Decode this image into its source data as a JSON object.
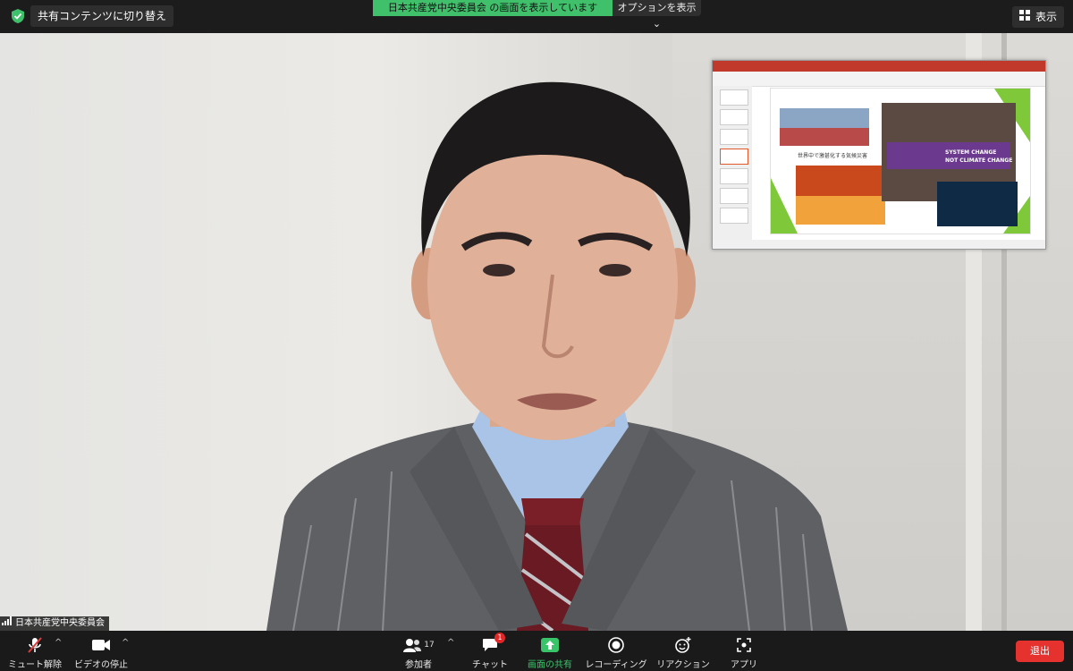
{
  "topbar": {
    "switch_label": "共有コンテンツに切り替え",
    "share_banner": "日本共産党中央委員会 の画面を表示しています",
    "options_label": "オプションを表示",
    "view_label": "表示"
  },
  "video": {
    "participant_name": "日本共産党中央委員会",
    "slide_caption": "世界中で激甚化する気候災害",
    "slide_banner": [
      "SYSTEM CHANGE",
      "NOT CLIMATE CHANGE"
    ]
  },
  "toolbar": {
    "mute_label": "ミュート解除",
    "video_label": "ビデオの停止",
    "participants_label": "参加者",
    "participants_count": "17",
    "chat_label": "チャット",
    "chat_badge": "1",
    "share_label": "画面の共有",
    "record_label": "レコーディング",
    "reaction_label": "リアクション",
    "apps_label": "アプリ",
    "leave_label": "退出"
  },
  "colors": {
    "banner_green": "#40c06a",
    "share_green": "#3ac46a",
    "leave_red": "#e5322e",
    "badge_red": "#e02828",
    "muted_red": "#e23b3b"
  }
}
